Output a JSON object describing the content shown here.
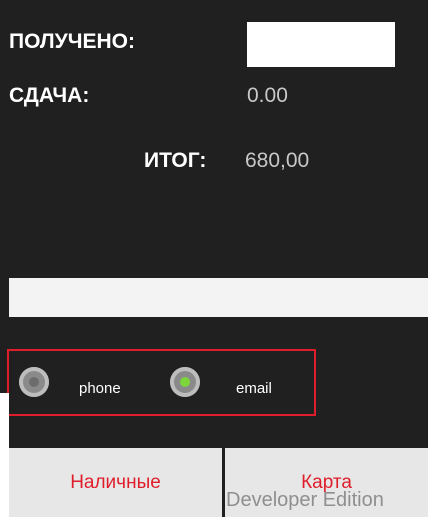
{
  "summary": {
    "received_label": "ПОЛУЧЕНО:",
    "received_value": "",
    "change_label": "СДАЧА:",
    "change_value": "0.00",
    "total_label": "ИТОГ:",
    "total_value": "680,00"
  },
  "email_input": {
    "value": ""
  },
  "receipt_options": {
    "phone_label": "phone",
    "email_label": "email",
    "selected": "email",
    "selected_color": "#7cd63a"
  },
  "payment_buttons": {
    "cash_label": "Наличные",
    "card_label": "Карта"
  },
  "watermark": "Developer Edition",
  "colors": {
    "accent": "#e01e2b",
    "background": "#202020"
  }
}
